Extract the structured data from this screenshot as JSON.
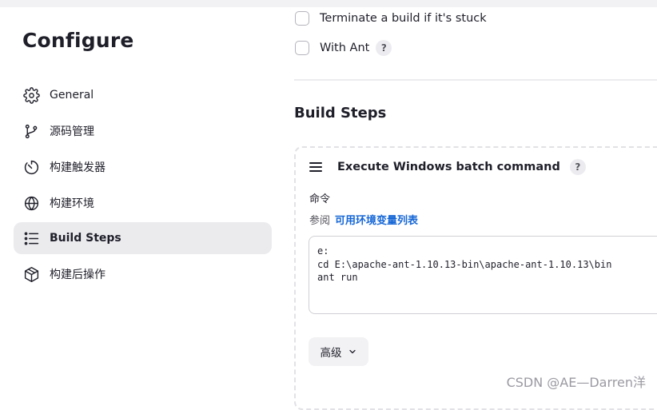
{
  "page": {
    "title": "Configure"
  },
  "sidebar": {
    "items": [
      {
        "label": "General",
        "icon": "gear-icon",
        "active": false
      },
      {
        "label": "源码管理",
        "icon": "branch-icon",
        "active": false
      },
      {
        "label": "构建触发器",
        "icon": "timer-icon",
        "active": false
      },
      {
        "label": "构建环境",
        "icon": "globe-icon",
        "active": false
      },
      {
        "label": "Build Steps",
        "icon": "list-icon",
        "active": true
      },
      {
        "label": "构建后操作",
        "icon": "package-icon",
        "active": false
      }
    ]
  },
  "options": {
    "terminate_stuck": {
      "label": "Terminate a build if it's stuck",
      "checked": false
    },
    "with_ant": {
      "label": "With Ant",
      "checked": false,
      "help": "?"
    }
  },
  "build_steps": {
    "title": "Build Steps",
    "step": {
      "title": "Execute Windows batch command",
      "help": "?",
      "command_label": "命令",
      "env_prefix": "参阅",
      "env_link": "可用环境变量列表",
      "command": "e:\ncd E:\\apache-ant-1.10.13-bin\\apache-ant-1.10.13\\bin\nant run",
      "advanced_label": "高级"
    }
  },
  "watermark": "CSDN @AE—Darren洋",
  "colors": {
    "link": "#1566d6",
    "active_nav_bg": "#ebebee"
  }
}
